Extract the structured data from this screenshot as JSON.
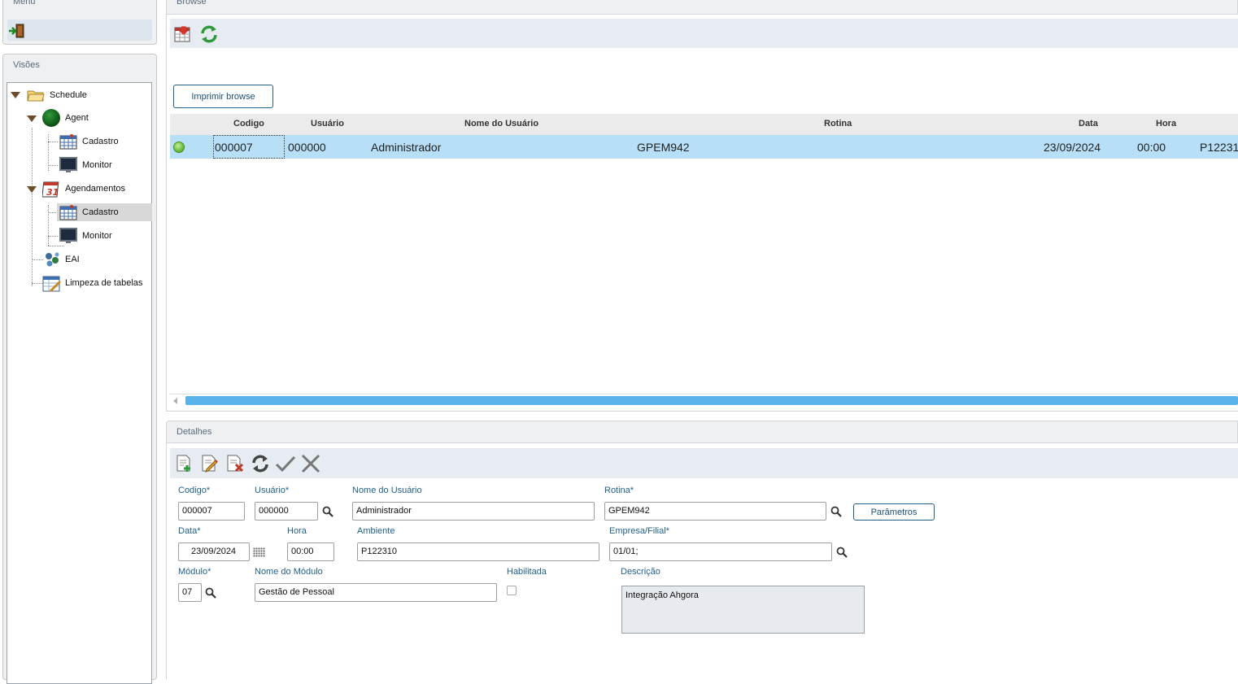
{
  "menu": {
    "title": "Menu",
    "exit_icon": "exit-door-icon"
  },
  "visoes": {
    "title": "Visões",
    "tree": {
      "schedule": "Schedule",
      "agent": "Agent",
      "agent_cadastro": "Cadastro",
      "agent_monitor": "Monitor",
      "agendamentos": "Agendamentos",
      "agend_cadastro": "Cadastro",
      "agend_monitor": "Monitor",
      "eai": "EAI",
      "limpeza": "Limpeza de tabelas"
    },
    "calendar_icon_text": "31"
  },
  "browse": {
    "title": "Browse",
    "print_button": "Imprimir browse",
    "columns": [
      "Codigo",
      "Usuário",
      "Nome do Usuário",
      "Rotina",
      "Data",
      "Hora"
    ],
    "row": {
      "codigo": "000007",
      "usuario": "000000",
      "nome": "Administrador",
      "rotina": "GPEM942",
      "data": "23/09/2024",
      "hora": "00:00",
      "extra": "P12231"
    }
  },
  "detalhes": {
    "title": "Detalhes",
    "labels": {
      "codigo": "Codigo*",
      "usuario": "Usuário*",
      "nome_usuario": "Nome do Usuário",
      "rotina": "Rotina*",
      "data": "Data*",
      "hora": "Hora",
      "ambiente": "Ambiente",
      "empresa": "Empresa/Filial*",
      "modulo": "Módulo*",
      "nome_modulo": "Nome do Módulo",
      "habilitada": "Habilitada",
      "descricao": "Descrição"
    },
    "values": {
      "codigo": "000007",
      "usuario": "000000",
      "nome_usuario": "Administrador",
      "rotina": "GPEM942",
      "data": "23/09/2024",
      "hora": "00:00",
      "ambiente": "P122310",
      "empresa": "01/01;",
      "modulo": "07",
      "nome_modulo": "Gestão de Pessoal",
      "descricao": "Integração Ahgora"
    },
    "params_button": "Parâmetros",
    "habilitada_checked": false
  },
  "colors": {
    "accent": "#1f5f8a",
    "selection": "#b7e0f8",
    "scroll": "#5ab4ec"
  }
}
